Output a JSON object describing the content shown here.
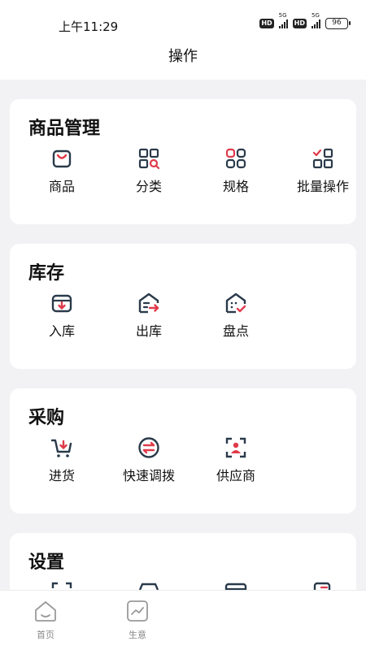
{
  "status_bar": {
    "time": "上午11:29",
    "hd_1": "HD",
    "net_1": "5G",
    "hd_2": "HD",
    "net_2": "5G",
    "battery": "96"
  },
  "header": {
    "title": "操作"
  },
  "sections": [
    {
      "title": "商品管理",
      "items": [
        {
          "label": "商品",
          "icon": "shopping-bag-icon"
        },
        {
          "label": "分类",
          "icon": "category-grid-search-icon"
        },
        {
          "label": "规格",
          "icon": "spec-grid-icon"
        },
        {
          "label": "批量操作",
          "icon": "batch-check-grid-icon"
        }
      ]
    },
    {
      "title": "库存",
      "items": [
        {
          "label": "入库",
          "icon": "inbound-box-icon"
        },
        {
          "label": "出库",
          "icon": "outbound-house-icon"
        },
        {
          "label": "盘点",
          "icon": "inventory-check-icon"
        }
      ]
    },
    {
      "title": "采购",
      "items": [
        {
          "label": "进货",
          "icon": "cart-purchase-icon"
        },
        {
          "label": "快速调拨",
          "icon": "transfer-arrows-icon"
        },
        {
          "label": "供应商",
          "icon": "supplier-person-icon"
        }
      ]
    },
    {
      "title": "设置",
      "items": []
    }
  ],
  "tabbar": {
    "items": [
      {
        "label": "首页",
        "icon": "home-icon"
      },
      {
        "label": "生意",
        "icon": "business-chart-icon"
      }
    ]
  },
  "colors": {
    "accent": "#e03a4a",
    "ink": "#2a3a4a",
    "background": "#f2f2f4",
    "card": "#ffffff"
  }
}
